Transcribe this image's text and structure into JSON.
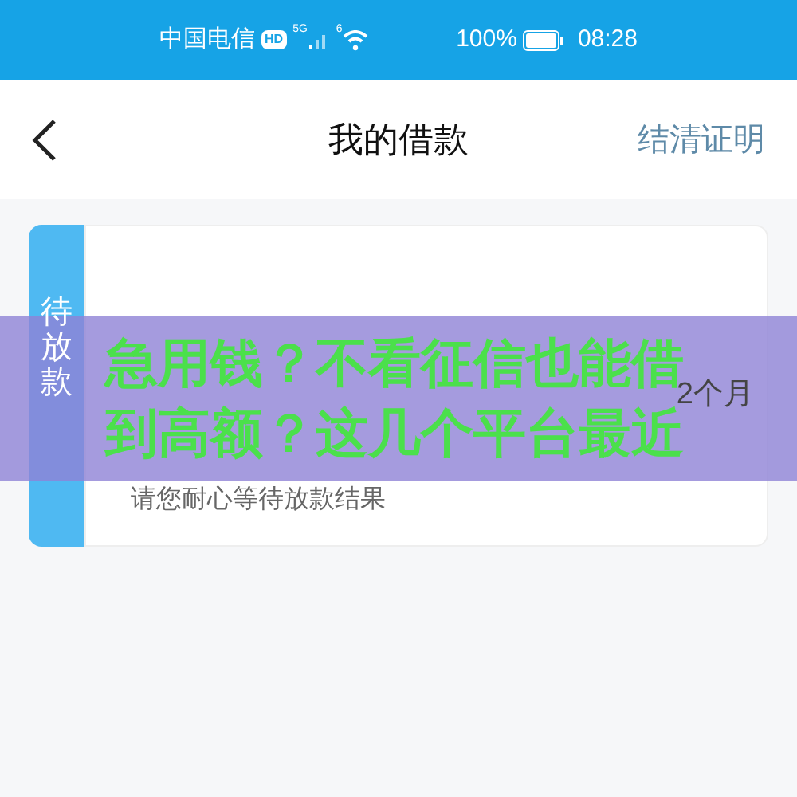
{
  "status_bar": {
    "carrier": "中国电信",
    "hd_badge": "HD",
    "network": "5G",
    "wifi_badge": "6",
    "battery": "100%",
    "time": "08:28"
  },
  "nav": {
    "title": "我的借款",
    "action": "结清证明"
  },
  "loan_card": {
    "status_tab": "待放款",
    "term": "2个月",
    "note": "请您耐心等待放款结果"
  },
  "overlay_banner": {
    "lines": [
      "急用钱？不看征信也能借",
      "到高额？这几个平台最近"
    ]
  }
}
